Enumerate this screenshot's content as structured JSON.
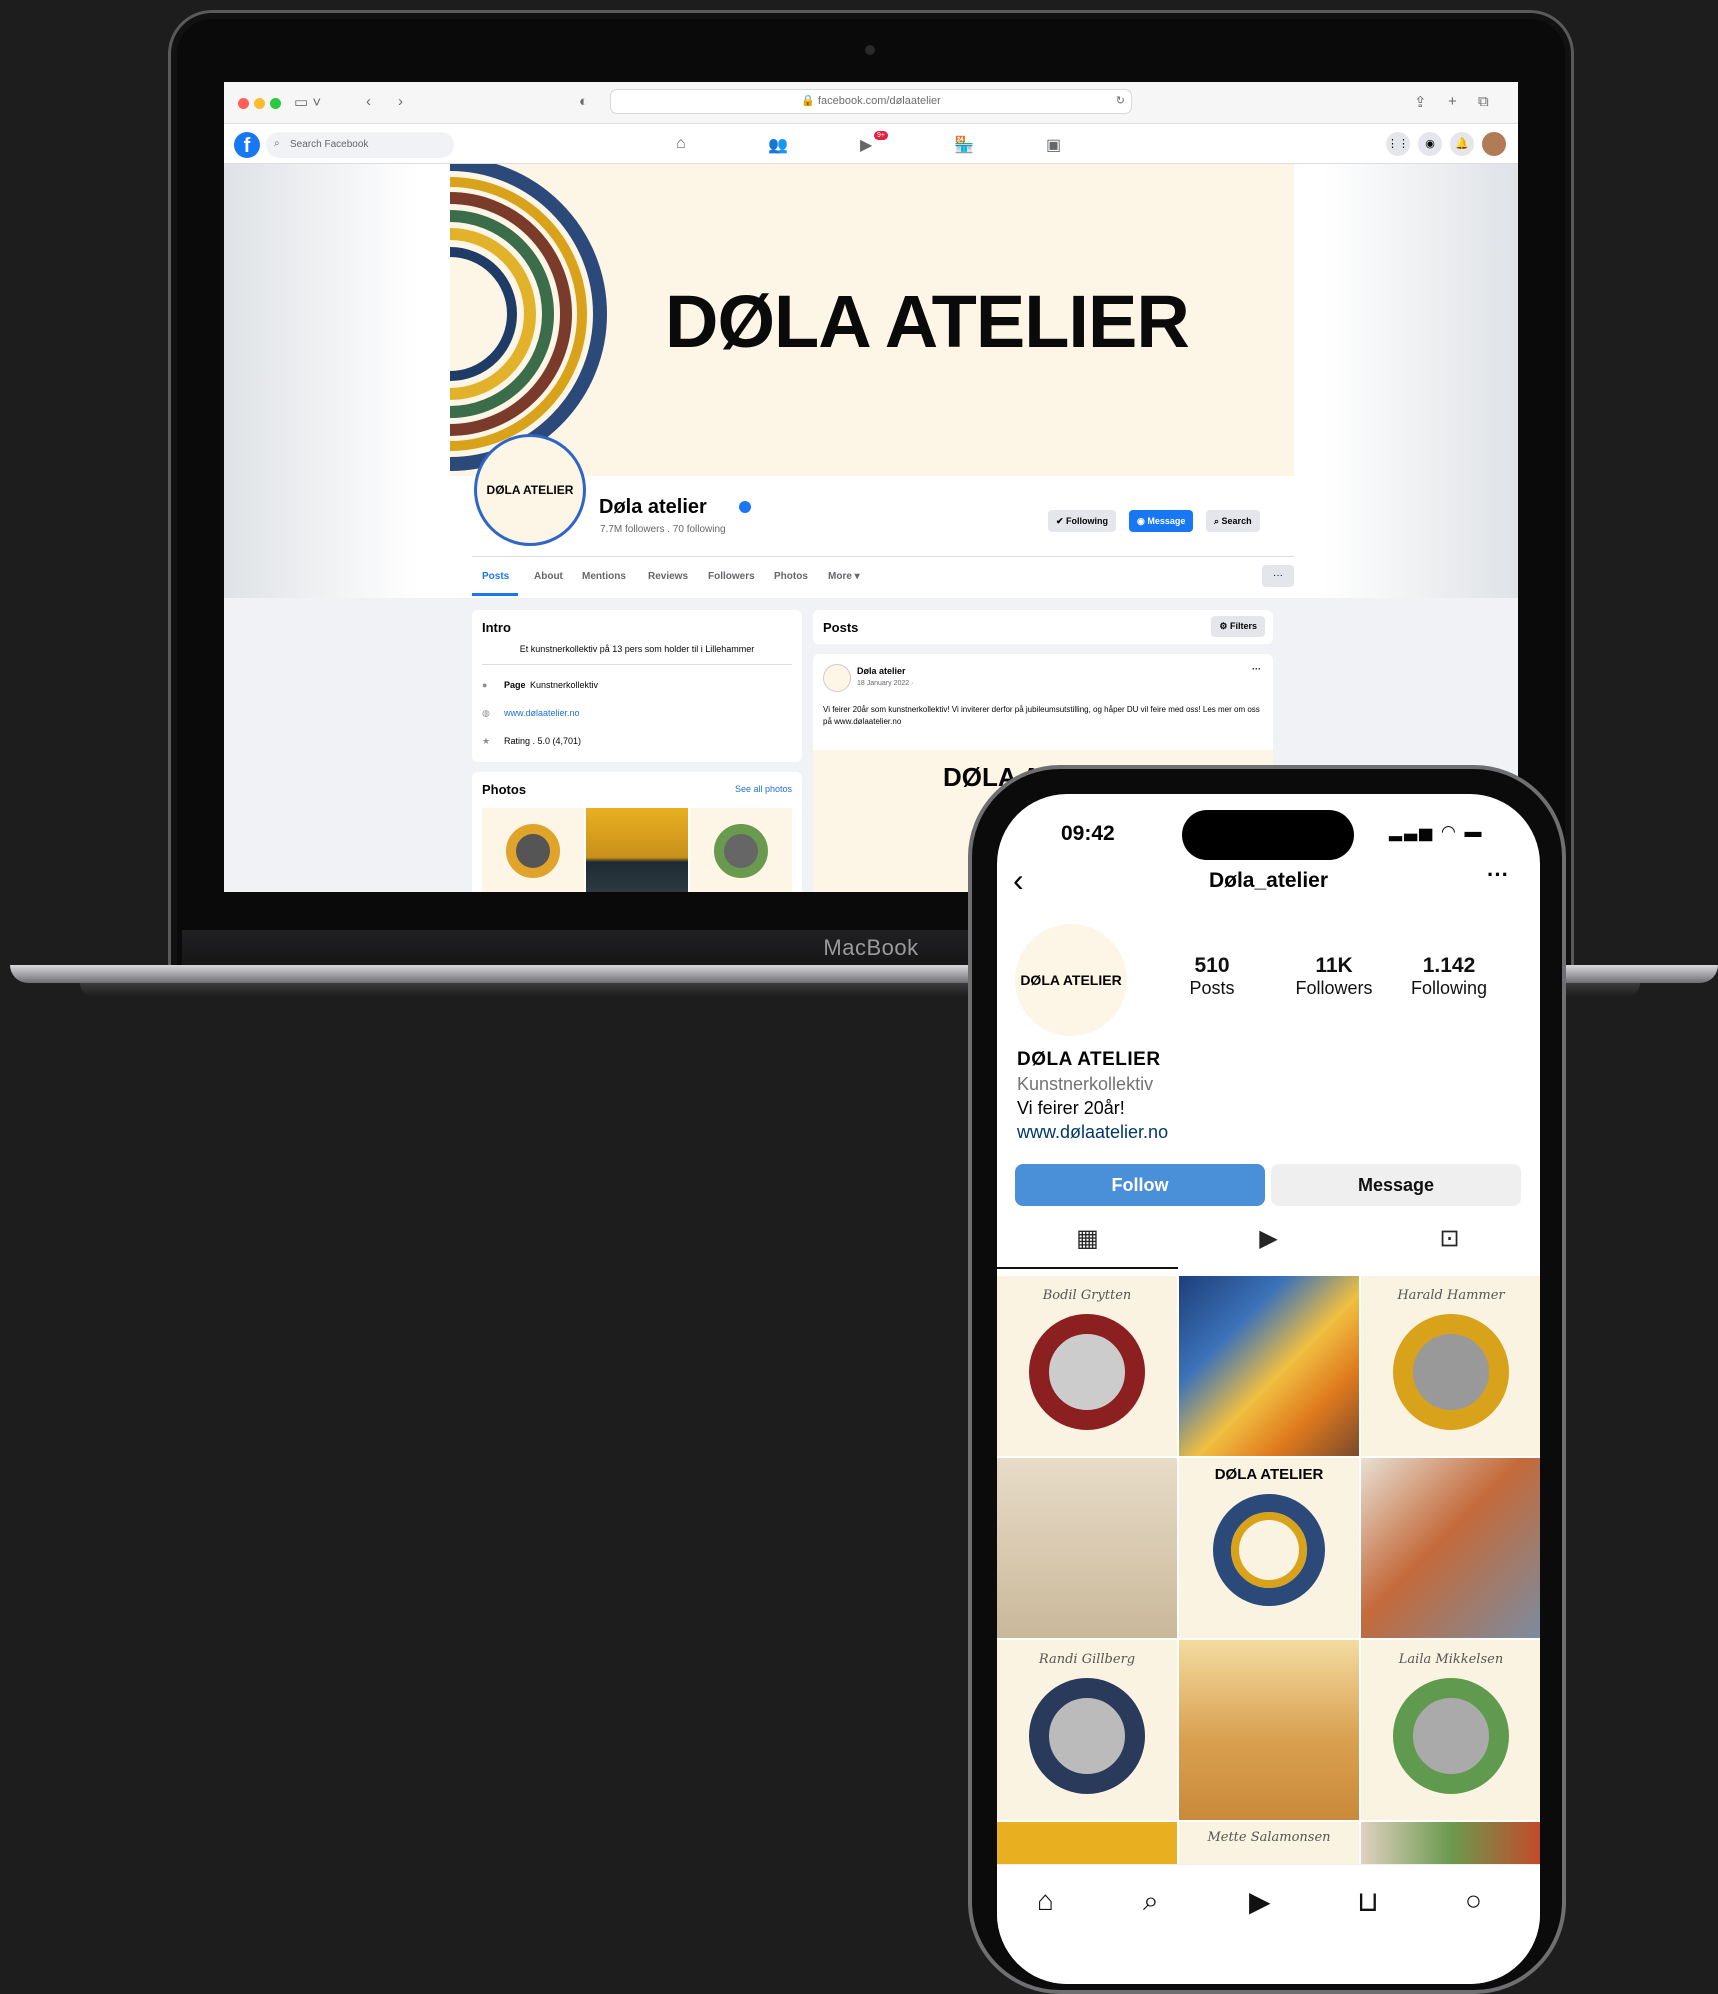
{
  "laptop": {
    "brand": "MacBook",
    "browser": {
      "url": "facebook.com/dølaatelier"
    },
    "facebook": {
      "search_placeholder": "Search Facebook",
      "notification_badge": "9+",
      "cover_title": "DØLA ATELIER",
      "avatar_text": "DØLA ATELIER",
      "page_name": "Døla atelier",
      "followers_line": "7.7M followers . 70 following",
      "buttons": {
        "following": "Following",
        "message": "Message",
        "search": "Search"
      },
      "tabs": [
        "Posts",
        "About",
        "Mentions",
        "Reviews",
        "Followers",
        "Photos",
        "More ▾"
      ],
      "more_button": "···",
      "intro": {
        "title": "Intro",
        "description": "Et kunstnerkollektiv på 13 pers som holder til i Lillehammer",
        "page_label": "Page",
        "page_category": "Kunstnerkollektiv",
        "website": "www.dølaatelier.no",
        "rating": "Rating . 5.0 (4,701)"
      },
      "photos": {
        "title": "Photos",
        "see_all": "See all photos"
      },
      "posts": {
        "title": "Posts",
        "filters": "Filters",
        "post_author": "Døla atelier",
        "post_date": "18 January 2022 ·",
        "post_text": "Vi feirer 20år som kunstnerkollektiv! Vi inviterer derfor på jubileumsutstilling, og håper DU vil feire med oss! Les mer om oss på www.dølaatelier.no",
        "post_image_text": "DØLA A"
      }
    }
  },
  "phone": {
    "time": "09:42",
    "username": "Døla_atelier",
    "avatar_text": "DØLA ATELIER",
    "stats": [
      {
        "value": "510",
        "label": "Posts"
      },
      {
        "value": "11K",
        "label": "Followers"
      },
      {
        "value": "1.142",
        "label": "Following"
      }
    ],
    "bio": {
      "name": "DØLA ATELIER",
      "category": "Kunstnerkollektiv",
      "line": "Vi feirer 20år!",
      "link": "www.dølaatelier.no"
    },
    "buttons": {
      "follow": "Follow",
      "message": "Message"
    },
    "grid_tiles": [
      {
        "caption": "Bodil Grytten"
      },
      {
        "caption": ""
      },
      {
        "caption": "Harald Hammer"
      },
      {
        "caption": ""
      },
      {
        "caption": "DØLA ATELIER"
      },
      {
        "caption": ""
      },
      {
        "caption": "Randi Gillberg"
      },
      {
        "caption": ""
      },
      {
        "caption": "Laila Mikkelsen"
      }
    ],
    "partial_tile_caption": "Mette Salamonsen",
    "colors": {
      "follow_blue": "#4a90d9",
      "fb_blue": "#1877f2",
      "cream": "#fdf5e6"
    }
  }
}
